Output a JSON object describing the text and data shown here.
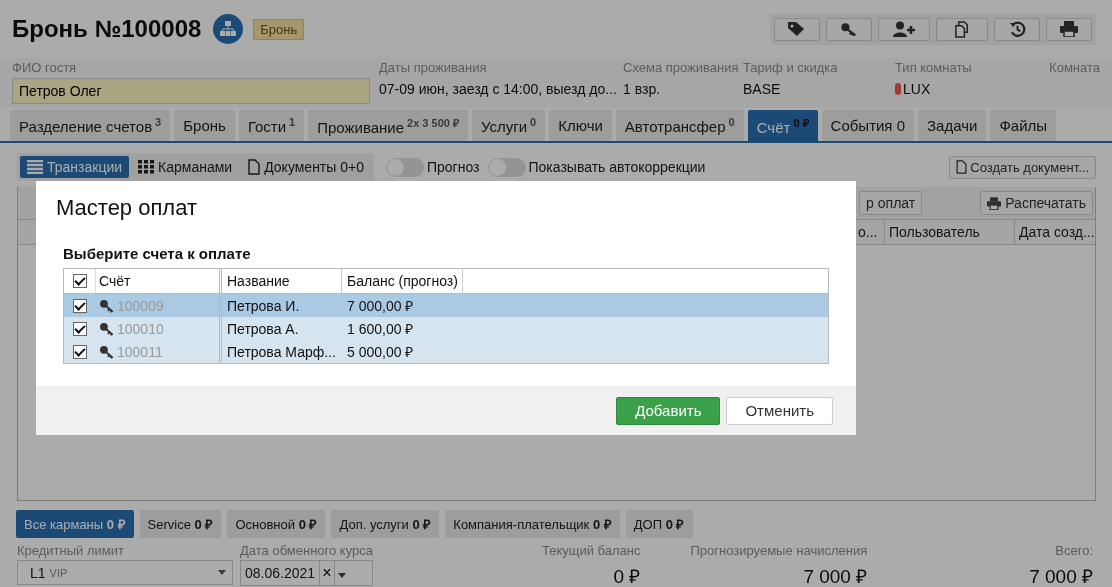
{
  "header": {
    "title": "Бронь №100008",
    "status": "Бронь"
  },
  "guest": {
    "label": "ФИО гостя",
    "value": "Петров Олег"
  },
  "stay": [
    {
      "label": "Даты проживания",
      "value": "07-09 июн, заезд с 14:00, выезд до..."
    },
    {
      "label": "Схема проживания",
      "value": "1 взр."
    },
    {
      "label": "Тариф и скидка",
      "value": "BASE"
    }
  ],
  "room_type": {
    "label": "Тип комнаты",
    "value": "LUX",
    "color": "#a33a32"
  },
  "room": {
    "label": "Комната"
  },
  "tabs": [
    {
      "label": "Разделение счетов",
      "badge": "3",
      "selected": false
    },
    {
      "label": "Бронь",
      "selected": false
    },
    {
      "label": "Гости",
      "badge": "1",
      "selected": false
    },
    {
      "label": "Проживание",
      "badge": "2x 3 500 ₽",
      "selected": false
    },
    {
      "label": "Услуги",
      "badge": "0",
      "selected": false
    },
    {
      "label": "Ключи",
      "selected": false
    },
    {
      "label": "Автотрансфер",
      "badge": "0",
      "selected": false
    },
    {
      "label": "Счёт",
      "badge": "0 ₽",
      "selected": true
    },
    {
      "label": "События 0",
      "selected": false
    },
    {
      "label": "Задачи",
      "selected": false
    },
    {
      "label": "Файлы",
      "selected": false
    }
  ],
  "view_modes": [
    {
      "label": "Транзакции",
      "kind": "list",
      "selected": true
    },
    {
      "label": "Карманами",
      "kind": "grid",
      "selected": false
    },
    {
      "label": "Документы 0+0",
      "kind": "document",
      "selected": false
    }
  ],
  "toggles": [
    {
      "label": "Прогноз",
      "on": false
    },
    {
      "label": "Показывать автокоррекции",
      "on": false
    }
  ],
  "create_document": "Создать документ...",
  "panel": {
    "buttons": [
      "р оплат",
      "Распечатать"
    ],
    "columns": [
      "о...",
      "Пользователь",
      "Дата созд..."
    ]
  },
  "pockets": [
    {
      "label": "Все карманы",
      "amount": "0 ₽",
      "selected": true
    },
    {
      "label": "Service",
      "amount": "0 ₽",
      "selected": false
    },
    {
      "label": "Основной",
      "amount": "0 ₽",
      "selected": false
    },
    {
      "label": "Доп. услуги",
      "amount": "0 ₽",
      "selected": false
    },
    {
      "label": "Компания-плательщик",
      "amount": "0 ₽",
      "selected": false
    },
    {
      "label": "ДОП",
      "amount": "0 ₽",
      "selected": false
    }
  ],
  "credit_limit": {
    "label": "Кредитный лимит",
    "value": "L1",
    "note": "VIP"
  },
  "exchange_date": {
    "label": "Дата обменного курса",
    "value": "08.06.2021",
    "clear": "×"
  },
  "totals": [
    {
      "label": "Текущий баланс",
      "value": "0 ₽"
    },
    {
      "label": "Прогнозируемые начисления",
      "value": "7 000 ₽"
    },
    {
      "label": "Всего:",
      "value": "7 000 ₽"
    }
  ],
  "dialog": {
    "title": "Мастер оплат",
    "subtitle": "Выберите счета к оплате",
    "all_checked": true,
    "columns": [
      "Счёт",
      "Название",
      "Баланс (прогноз)"
    ],
    "rows": [
      {
        "checked": true,
        "selected": true,
        "account": "100009",
        "name": "Петрова И.",
        "balance": "7 000,00 ₽"
      },
      {
        "checked": true,
        "selected": false,
        "account": "100010",
        "name": "Петрова А.",
        "balance": "1 600,00 ₽"
      },
      {
        "checked": true,
        "selected": false,
        "account": "100011",
        "name": "Петрова Марф...",
        "balance": "5 000,00 ₽"
      }
    ],
    "buttons": [
      {
        "label": "Добавить",
        "kind": "primary"
      },
      {
        "label": "Отменить",
        "kind": "secondary"
      }
    ]
  }
}
